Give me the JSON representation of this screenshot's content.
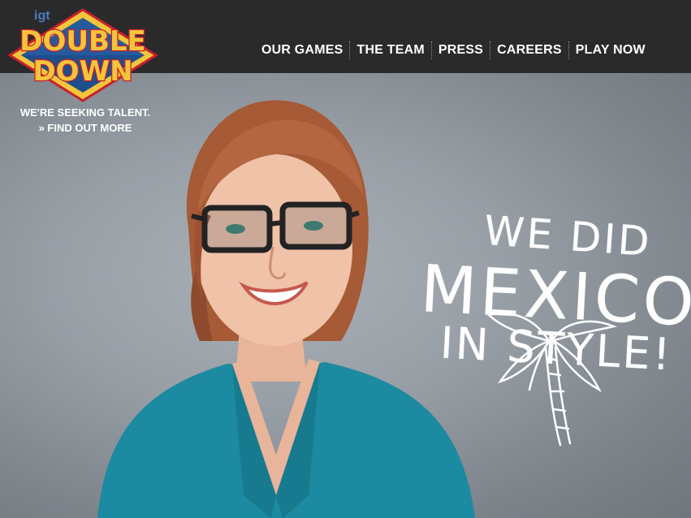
{
  "header": {
    "logo": {
      "brand_small": "igt",
      "line1": "DOUBLE",
      "line2": "DOWN"
    },
    "nav": [
      {
        "label": "OUR GAMES"
      },
      {
        "label": "THE TEAM"
      },
      {
        "label": "PRESS"
      },
      {
        "label": "CAREERS"
      },
      {
        "label": "PLAY NOW"
      }
    ]
  },
  "promo": {
    "line1": "WE'RE SEEKING TALENT.",
    "link": "» FIND OUT MORE"
  },
  "hero": {
    "chalk_line1": "WE DID",
    "chalk_line2": "MEXICO",
    "chalk_line3": "IN STYLE!"
  },
  "colors": {
    "header_bg": "#2a2a2a",
    "logo_gold": "#f3c53b",
    "logo_red": "#c8202c",
    "logo_blue": "#1f4e8c",
    "shirt_teal": "#1c8aa0",
    "text_white": "#ffffff"
  }
}
